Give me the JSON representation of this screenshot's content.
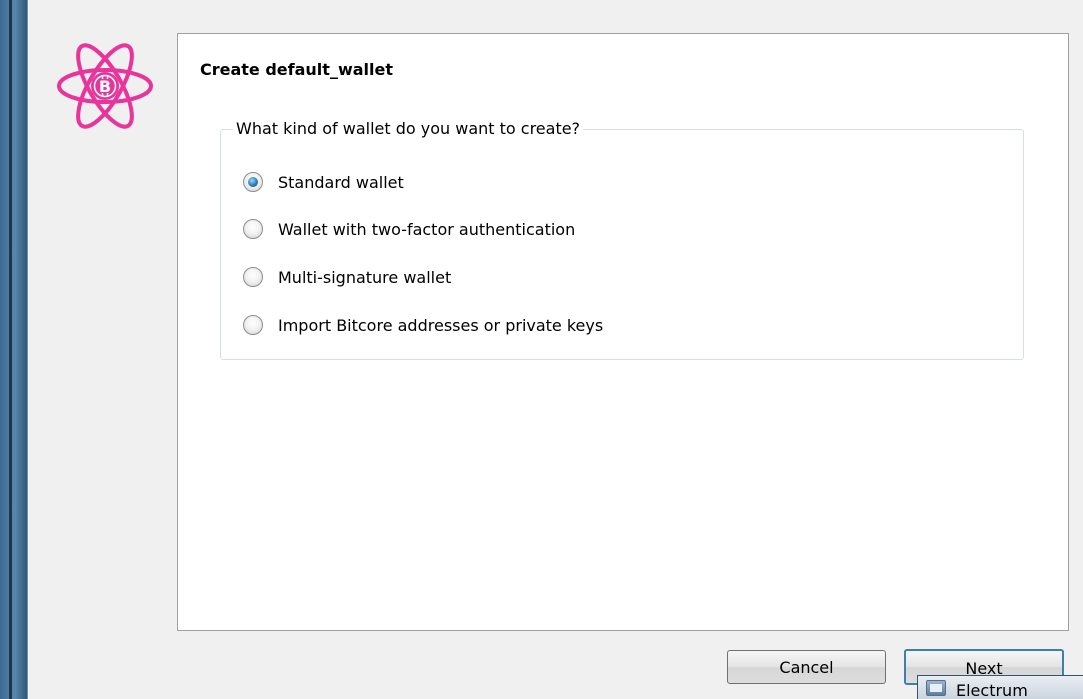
{
  "wizard": {
    "title": "Create default_wallet",
    "question": "What kind of wallet do you want to create?",
    "options": [
      {
        "label": "Standard wallet",
        "selected": true
      },
      {
        "label": "Wallet with two-factor authentication",
        "selected": false
      },
      {
        "label": "Multi-signature wallet",
        "selected": false
      },
      {
        "label": "Import Bitcore addresses or private keys",
        "selected": false
      }
    ],
    "logo_icon": "bitcore-atom-logo-icon",
    "accent_color": "#e8359b"
  },
  "buttons": {
    "cancel_label": "Cancel",
    "next_label": "Next"
  },
  "taskbar": {
    "app_label": "Electrum",
    "icon": "window-icon"
  }
}
